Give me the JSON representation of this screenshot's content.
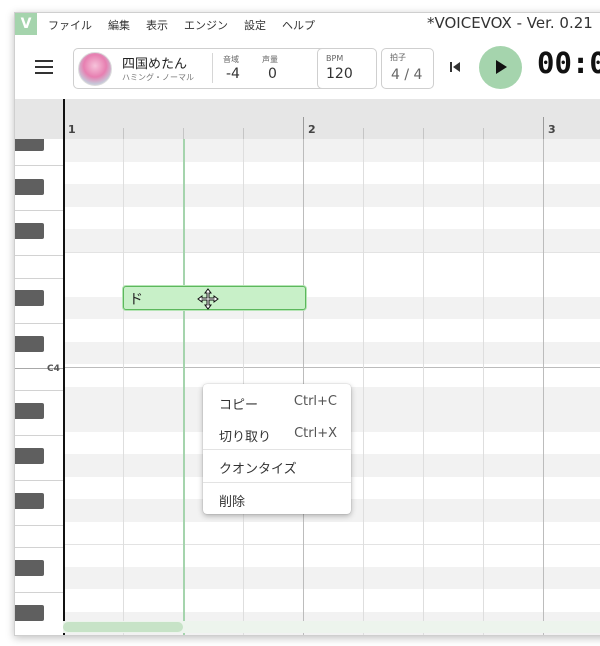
{
  "window": {
    "title": "*VOICEVOX - Ver. 0.21"
  },
  "app": {
    "icon_letter": "V"
  },
  "menu": [
    "ファイル",
    "編集",
    "表示",
    "エンジン",
    "設定",
    "ヘルプ"
  ],
  "character": {
    "name": "四国めたん",
    "style": "ハミング・ノーマル",
    "range_label": "音域",
    "range_value": "-4",
    "volume_label": "声量",
    "volume_value": "0"
  },
  "tempo": {
    "label": "BPM",
    "value": "120"
  },
  "time_signature": {
    "label": "拍子",
    "value": "4 / 4"
  },
  "transport": {
    "time": "00:0"
  },
  "ruler": {
    "measures": [
      "1",
      "2",
      "3"
    ]
  },
  "piano": {
    "c4_label": "C4"
  },
  "note": {
    "lyric": "ド"
  },
  "context_menu": {
    "copy": {
      "label": "コピー",
      "shortcut": "Ctrl+C"
    },
    "cut": {
      "label": "切り取り",
      "shortcut": "Ctrl+X"
    },
    "quantize": {
      "label": "クオンタイズ"
    },
    "delete": {
      "label": "削除"
    }
  },
  "colors": {
    "accent": "#a5d4ad",
    "note_fill": "#c8f0c8",
    "note_border": "#5cb85c"
  },
  "icons": [
    "menu-icon",
    "skip-back-icon",
    "play-icon",
    "move-cursor-icon"
  ]
}
